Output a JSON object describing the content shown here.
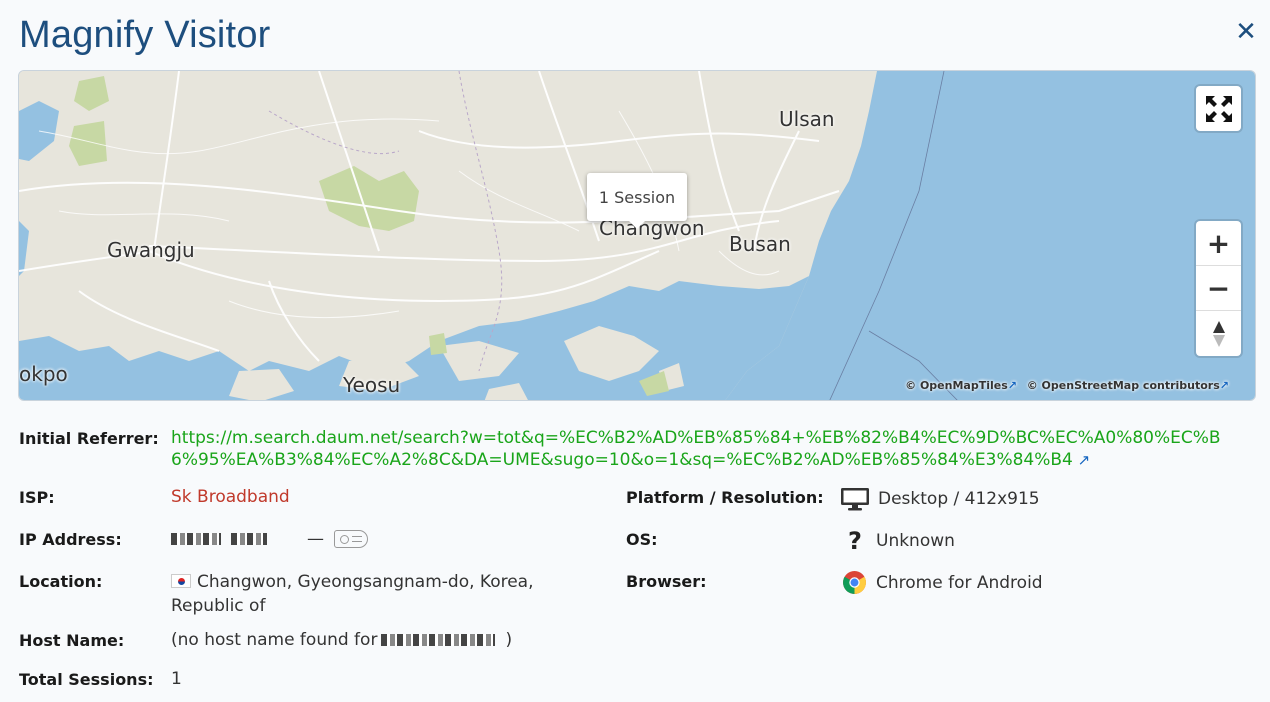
{
  "header": {
    "title": "Magnify Visitor"
  },
  "map": {
    "cities": [
      "Ulsan",
      "Gwangju",
      "Changwon",
      "Busan",
      "Yeosu",
      "okpo"
    ],
    "popup_text": "1 Session",
    "zoom_in": "+",
    "zoom_out": "−",
    "compass": "⬍",
    "attribution_tiles": "© OpenMapTiles",
    "attribution_osm": "© OpenStreetMap contributors",
    "colors": {
      "water": "#94c1e1",
      "land": "#e7e5dc",
      "park": "#c7d8a4",
      "roads": "#ffffff"
    }
  },
  "details": {
    "initial_referrer_label": "Initial Referrer:",
    "initial_referrer": "https://m.search.daum.net/search?w=tot&q=%EC%B2%AD%EB%85%84+%EB%82%B4%EC%9D%BC%EC%A0%80%EC%B6%95%EA%B3%84%EC%A2%8C&DA=UME&sugo=10&o=1&sq=%EC%B2%AD%EB%85%84%E3%84%B4",
    "isp_label": "ISP:",
    "isp": "Sk Broadband",
    "ip_label": "IP Address:",
    "ip_dash": "—",
    "location_label": "Location:",
    "location": "Changwon, Gyeongsangnam-do, Korea, Republic of",
    "host_label": "Host Name:",
    "host_prefix": "(no host name found for",
    "host_suffix": ")",
    "sessions_label": "Total Sessions:",
    "sessions": "1",
    "platform_label": "Platform / Resolution:",
    "platform": "Desktop / 412x915",
    "os_label": "OS:",
    "os": "Unknown",
    "browser_label": "Browser:",
    "browser": "Chrome for Android"
  }
}
